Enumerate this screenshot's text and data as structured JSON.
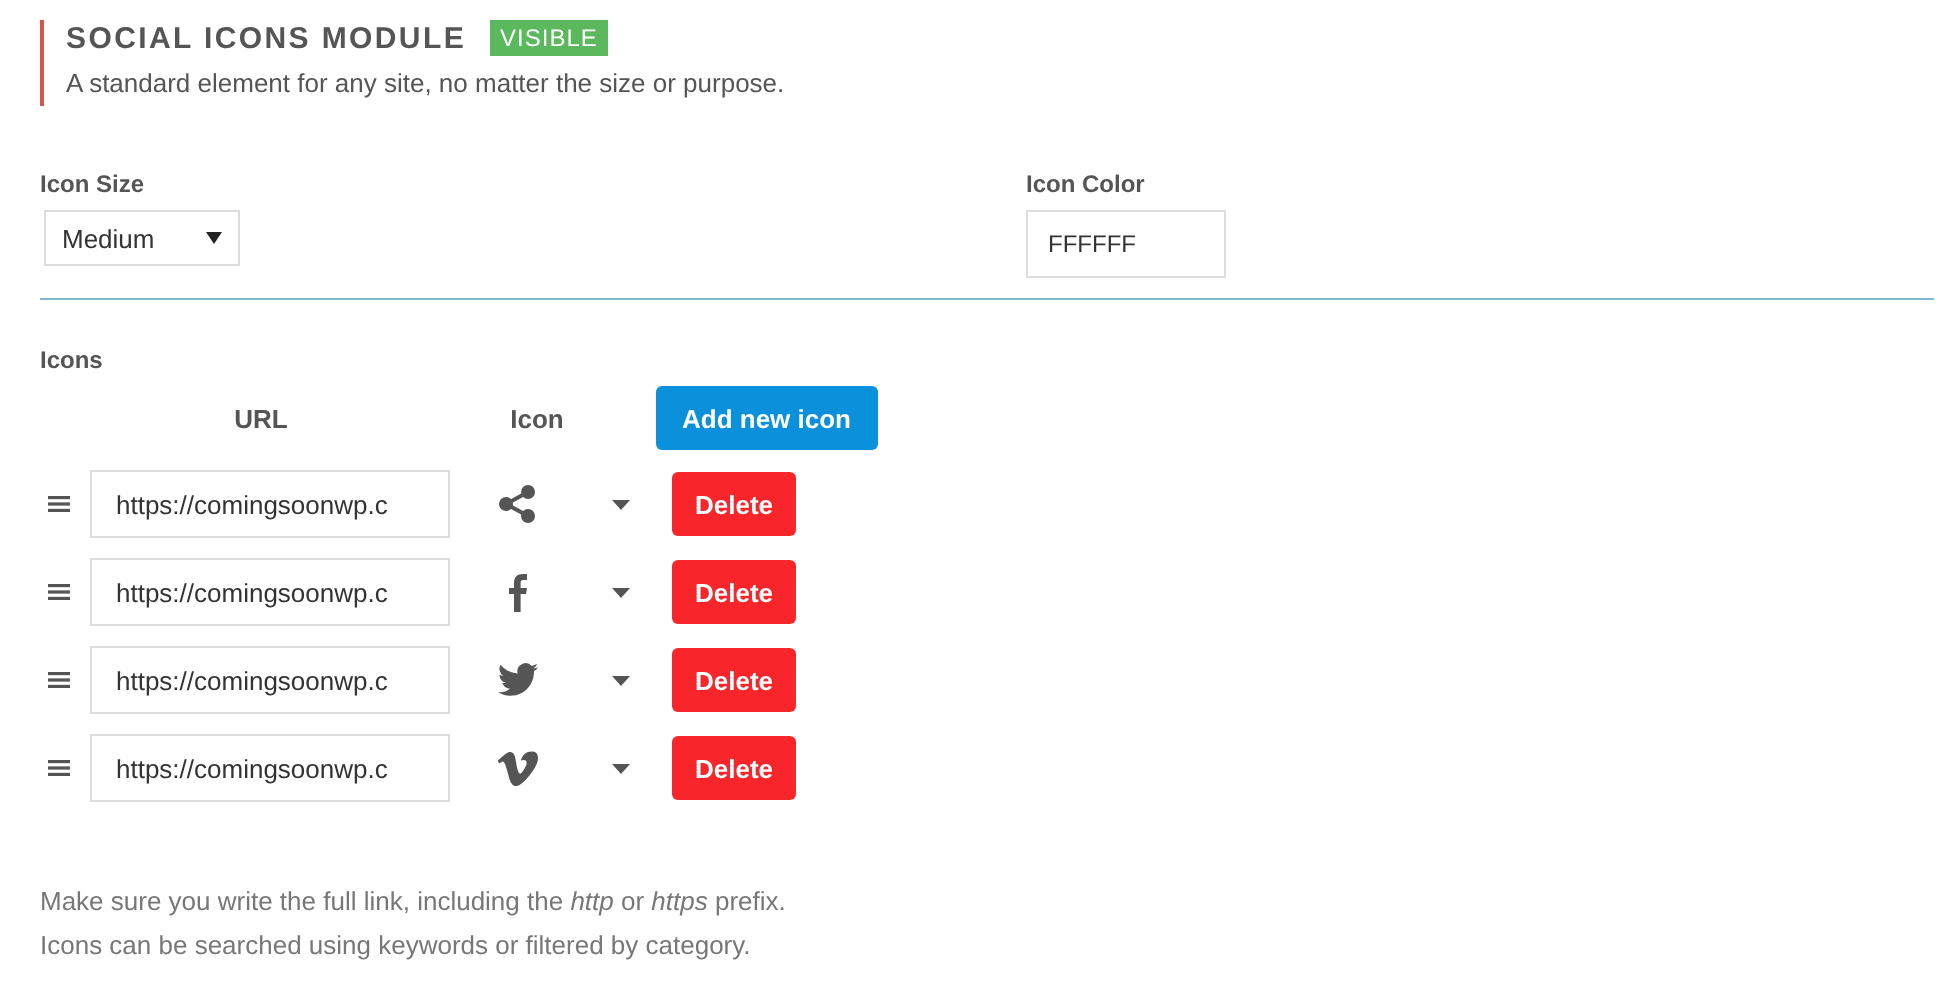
{
  "module": {
    "title": "SOCIAL ICONS MODULE",
    "badge": "VISIBLE",
    "description": "A standard element for any site, no matter the size or purpose."
  },
  "icon_size": {
    "label": "Icon Size",
    "value": "Medium"
  },
  "icon_color": {
    "label": "Icon Color",
    "value": "FFFFFF"
  },
  "icons": {
    "label": "Icons",
    "columns": [
      "URL",
      "Icon"
    ],
    "add_button": "Add new icon",
    "rows": [
      {
        "url": "https://comingsoonwp.c",
        "kind": "share",
        "delete": "Delete"
      },
      {
        "url": "https://comingsoonwp.c",
        "kind": "facebook",
        "delete": "Delete"
      },
      {
        "url": "https://comingsoonwp.c",
        "kind": "twitter",
        "delete": "Delete"
      },
      {
        "url": "https://comingsoonwp.c",
        "kind": "vimeo",
        "delete": "Delete"
      }
    ]
  },
  "notes": [
    "Make sure you write the full link, including the *http* or *https* prefix.",
    "Icons can be searched using keywords or filtered by category."
  ]
}
